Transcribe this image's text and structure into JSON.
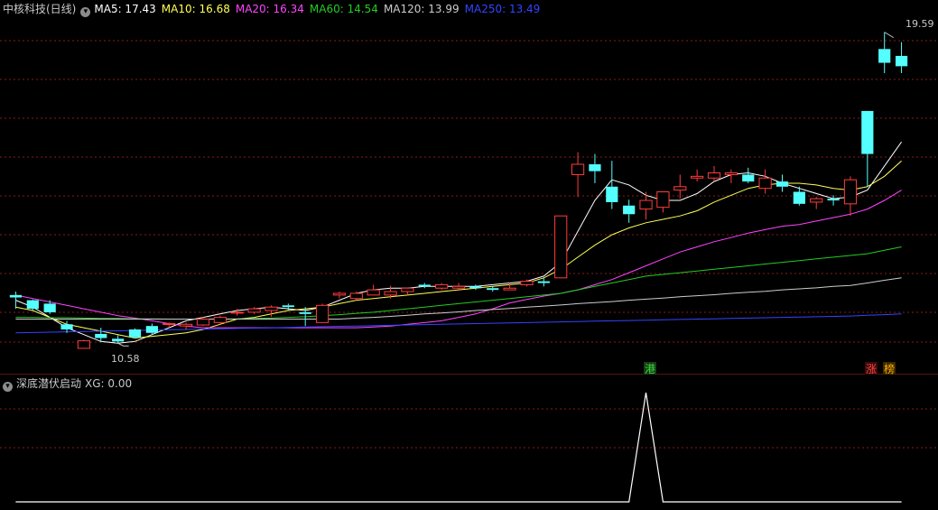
{
  "price_panel": {
    "title": "中核科技(日线)",
    "ma_labels": [
      {
        "text": "MA5: 17.43",
        "color": "#ffffff"
      },
      {
        "text": "MA10: 16.68",
        "color": "#ffff55"
      },
      {
        "text": "MA20: 16.34",
        "color": "#ff44ff"
      },
      {
        "text": "MA60: 14.54",
        "color": "#22cc22"
      },
      {
        "text": "MA120: 13.99",
        "color": "#cccccc"
      },
      {
        "text": "MA250: 13.49",
        "color": "#3344ff"
      }
    ],
    "high_label": "19.59",
    "low_label": "10.58",
    "tag_port": "港",
    "tag_zhang": "涨",
    "tag_bang": "榜"
  },
  "indicator_panel": {
    "title": "深底潜伏启动",
    "value_label": "XG: 0.00"
  },
  "colors": {
    "up": "#ff3c3c",
    "down": "#54ffff",
    "grid": "#8b1a1a",
    "xg_line": "#ffffff"
  },
  "chart_data": {
    "type": "candlestick",
    "ohlc": [
      [
        11.95,
        12.05,
        11.55,
        11.88
      ],
      [
        11.8,
        11.82,
        11.5,
        11.55
      ],
      [
        11.7,
        11.8,
        11.4,
        11.45
      ],
      [
        11.1,
        11.2,
        10.85,
        10.95
      ],
      [
        10.4,
        10.45,
        10.65,
        10.62
      ],
      [
        10.82,
        11.0,
        10.58,
        10.7
      ],
      [
        10.68,
        10.78,
        10.55,
        10.6
      ],
      [
        10.95,
        10.98,
        10.7,
        10.72
      ],
      [
        11.05,
        11.12,
        10.8,
        10.85
      ],
      [
        11.1,
        11.15,
        11.0,
        11.12
      ],
      [
        11.05,
        11.15,
        10.95,
        11.1
      ],
      [
        11.08,
        11.32,
        11.05,
        11.25
      ],
      [
        11.15,
        11.35,
        11.1,
        11.3
      ],
      [
        11.45,
        11.55,
        11.35,
        11.45
      ],
      [
        11.45,
        11.6,
        11.4,
        11.55
      ],
      [
        11.5,
        11.65,
        11.32,
        11.6
      ],
      [
        11.65,
        11.7,
        11.5,
        11.6
      ],
      [
        11.45,
        11.6,
        11.05,
        11.4
      ],
      [
        11.15,
        11.7,
        11.15,
        11.65
      ],
      [
        11.95,
        12.05,
        11.85,
        12.0
      ],
      [
        11.85,
        12.05,
        11.8,
        12.0
      ],
      [
        11.95,
        12.25,
        11.95,
        12.1
      ],
      [
        11.95,
        12.22,
        11.85,
        12.05
      ],
      [
        12.05,
        12.15,
        11.95,
        12.15
      ],
      [
        12.25,
        12.3,
        12.15,
        12.2
      ],
      [
        12.15,
        12.3,
        12.1,
        12.25
      ],
      [
        12.15,
        12.3,
        12.1,
        12.2
      ],
      [
        12.2,
        12.25,
        12.1,
        12.15
      ],
      [
        12.15,
        12.2,
        12.05,
        12.1
      ],
      [
        12.1,
        12.3,
        12.1,
        12.15
      ],
      [
        12.25,
        12.4,
        12.2,
        12.35
      ],
      [
        12.35,
        12.45,
        12.2,
        12.3
      ],
      [
        12.45,
        14.25,
        12.6,
        14.25
      ],
      [
        15.45,
        16.1,
        14.8,
        15.75
      ],
      [
        15.75,
        16.05,
        15.2,
        15.55
      ],
      [
        15.1,
        15.85,
        14.45,
        14.65
      ],
      [
        14.55,
        14.72,
        14.05,
        14.3
      ],
      [
        14.45,
        14.95,
        14.15,
        14.7
      ],
      [
        14.5,
        14.95,
        14.35,
        14.95
      ],
      [
        15.0,
        15.45,
        14.75,
        15.1
      ],
      [
        15.35,
        15.6,
        15.25,
        15.4
      ],
      [
        15.35,
        15.7,
        15.25,
        15.5
      ],
      [
        15.45,
        15.6,
        15.2,
        15.5
      ],
      [
        15.45,
        15.65,
        15.2,
        15.25
      ],
      [
        15.05,
        15.6,
        14.9,
        15.35
      ],
      [
        15.25,
        15.45,
        14.95,
        15.1
      ],
      [
        14.95,
        15.1,
        14.55,
        14.6
      ],
      [
        14.65,
        14.8,
        14.45,
        14.75
      ],
      [
        14.75,
        14.85,
        14.55,
        14.7
      ],
      [
        14.6,
        15.4,
        14.25,
        15.3
      ],
      [
        17.3,
        17.3,
        15.1,
        16.05
      ],
      [
        19.1,
        19.59,
        18.4,
        18.7
      ],
      [
        18.9,
        19.3,
        18.4,
        18.6
      ]
    ],
    "ma_series": [
      {
        "name": "MA5",
        "color": "#ffffff",
        "values": [
          11.8,
          11.6,
          11.3,
          11.0,
          10.8,
          10.6,
          10.55,
          10.6,
          10.8,
          11.0,
          11.2,
          11.3,
          11.4,
          11.5,
          11.55,
          11.6,
          11.55,
          11.5,
          11.6,
          11.8,
          12.0,
          12.1,
          12.15,
          12.15,
          12.2,
          12.2,
          12.2,
          12.2,
          12.25,
          12.3,
          12.35,
          12.5,
          12.9,
          13.8,
          14.7,
          15.3,
          15.15,
          14.85,
          14.7,
          14.7,
          14.9,
          15.25,
          15.45,
          15.5,
          15.4,
          15.2,
          15.05,
          14.9,
          14.75,
          14.8,
          15.0,
          15.7,
          16.4
        ]
      },
      {
        "name": "MA10",
        "color": "#ffff55",
        "values": [
          11.6,
          11.5,
          11.3,
          11.1,
          11.0,
          10.9,
          10.8,
          10.7,
          10.75,
          10.8,
          10.85,
          10.95,
          11.1,
          11.25,
          11.3,
          11.4,
          11.5,
          11.55,
          11.6,
          11.7,
          11.8,
          11.85,
          11.9,
          11.95,
          12.0,
          12.05,
          12.1,
          12.15,
          12.2,
          12.25,
          12.3,
          12.45,
          12.7,
          13.05,
          13.4,
          13.7,
          13.9,
          14.05,
          14.15,
          14.25,
          14.4,
          14.65,
          14.85,
          15.05,
          15.15,
          15.2,
          15.2,
          15.15,
          15.05,
          15.0,
          15.1,
          15.4,
          15.85
        ]
      },
      {
        "name": "MA20",
        "color": "#ff44ff",
        "values": [
          11.95,
          11.85,
          11.75,
          11.65,
          11.55,
          11.45,
          11.35,
          11.28,
          11.2,
          11.12,
          11.05,
          11.0,
          11.0,
          11.0,
          11.0,
          11.0,
          11.0,
          11.0,
          11.0,
          11.0,
          11.0,
          11.02,
          11.05,
          11.1,
          11.15,
          11.2,
          11.3,
          11.4,
          11.55,
          11.72,
          11.82,
          11.92,
          12.0,
          12.1,
          12.25,
          12.4,
          12.6,
          12.8,
          13.0,
          13.2,
          13.35,
          13.5,
          13.62,
          13.75,
          13.85,
          13.95,
          14.0,
          14.1,
          14.2,
          14.3,
          14.45,
          14.7,
          15.0
        ]
      },
      {
        "name": "MA60",
        "color": "#22cc22",
        "values": [
          11.3,
          11.3,
          11.29,
          11.29,
          11.28,
          11.27,
          11.27,
          11.26,
          11.26,
          11.25,
          11.25,
          11.25,
          11.25,
          11.26,
          11.27,
          11.28,
          11.3,
          11.32,
          11.35,
          11.38,
          11.42,
          11.45,
          11.5,
          11.55,
          11.6,
          11.65,
          11.7,
          11.75,
          11.8,
          11.85,
          11.9,
          11.95,
          12.0,
          12.1,
          12.2,
          12.3,
          12.4,
          12.5,
          12.55,
          12.6,
          12.65,
          12.7,
          12.75,
          12.8,
          12.85,
          12.9,
          12.95,
          13.0,
          13.05,
          13.1,
          13.15,
          13.25,
          13.35
        ]
      },
      {
        "name": "MA120",
        "color": "#cccccc",
        "values": [
          11.25,
          11.25,
          11.25,
          11.25,
          11.25,
          11.25,
          11.25,
          11.25,
          11.25,
          11.25,
          11.25,
          11.25,
          11.25,
          11.25,
          11.25,
          11.25,
          11.25,
          11.25,
          11.25,
          11.25,
          11.28,
          11.3,
          11.33,
          11.36,
          11.4,
          11.43,
          11.46,
          11.5,
          11.53,
          11.56,
          11.6,
          11.63,
          11.66,
          11.7,
          11.73,
          11.76,
          11.8,
          11.83,
          11.86,
          11.9,
          11.93,
          11.96,
          12.0,
          12.03,
          12.06,
          12.1,
          12.13,
          12.16,
          12.2,
          12.23,
          12.3,
          12.38,
          12.45
        ]
      },
      {
        "name": "MA250",
        "color": "#3344ff",
        "values": [
          10.85,
          10.86,
          10.87,
          10.88,
          10.89,
          10.9,
          10.91,
          10.92,
          10.93,
          10.94,
          10.95,
          10.96,
          10.97,
          10.98,
          10.99,
          11.0,
          11.01,
          11.02,
          11.03,
          11.04,
          11.05,
          11.06,
          11.07,
          11.08,
          11.09,
          11.1,
          11.11,
          11.12,
          11.13,
          11.14,
          11.15,
          11.16,
          11.17,
          11.18,
          11.19,
          11.2,
          11.21,
          11.22,
          11.23,
          11.24,
          11.25,
          11.26,
          11.27,
          11.28,
          11.29,
          11.3,
          11.31,
          11.32,
          11.33,
          11.34,
          11.36,
          11.38,
          11.4
        ]
      }
    ],
    "xg_values": [
      0,
      0,
      0,
      0,
      0,
      0,
      0,
      0,
      0,
      0,
      0,
      0,
      0,
      0,
      0,
      0,
      0,
      0,
      0,
      0,
      0,
      0,
      0,
      0,
      0,
      0,
      0,
      0,
      0,
      0,
      0,
      0,
      0,
      0,
      0,
      0,
      0,
      1,
      0,
      0,
      0,
      0,
      0,
      0,
      0,
      0,
      0,
      0,
      0,
      0,
      0,
      0,
      0
    ],
    "y_range": [
      9.9,
      20.0
    ],
    "grid": true
  }
}
